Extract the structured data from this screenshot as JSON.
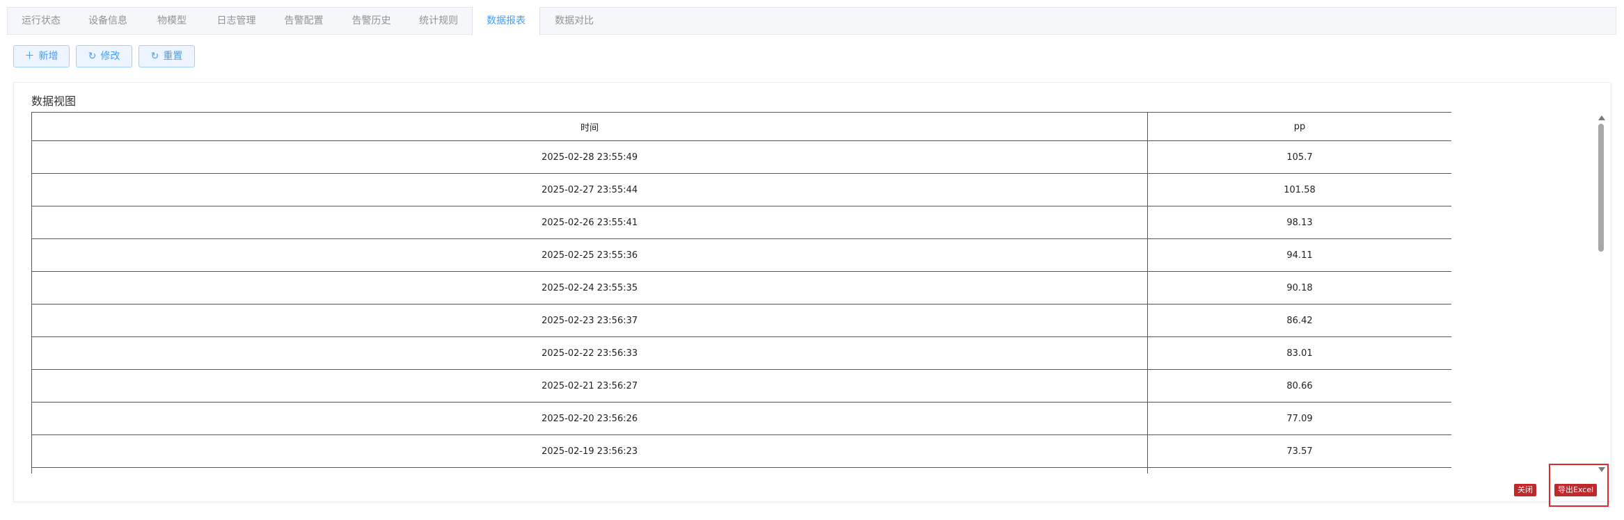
{
  "tabs": [
    {
      "label": "运行状态"
    },
    {
      "label": "设备信息"
    },
    {
      "label": "物模型"
    },
    {
      "label": "日志管理"
    },
    {
      "label": "告警配置"
    },
    {
      "label": "告警历史"
    },
    {
      "label": "统计规则"
    },
    {
      "label": "数据报表",
      "active": true
    },
    {
      "label": "数据对比"
    }
  ],
  "toolbar": {
    "add": {
      "icon": "plus-icon",
      "label": "新增"
    },
    "edit": {
      "icon": "refresh-icon",
      "label": "修改"
    },
    "reset": {
      "icon": "refresh-icon",
      "label": "重置"
    }
  },
  "card": {
    "title": "数据视图"
  },
  "table": {
    "columns": [
      "时间",
      "pp"
    ],
    "rows": [
      [
        "2025-02-28 23:55:49",
        "105.7"
      ],
      [
        "2025-02-27 23:55:44",
        "101.58"
      ],
      [
        "2025-02-26 23:55:41",
        "98.13"
      ],
      [
        "2025-02-25 23:55:36",
        "94.11"
      ],
      [
        "2025-02-24 23:55:35",
        "90.18"
      ],
      [
        "2025-02-23 23:56:37",
        "86.42"
      ],
      [
        "2025-02-22 23:56:33",
        "83.01"
      ],
      [
        "2025-02-21 23:56:27",
        "80.66"
      ],
      [
        "2025-02-20 23:56:26",
        "77.09"
      ],
      [
        "2025-02-19 23:56:23",
        "73.57"
      ],
      [
        "",
        ""
      ]
    ]
  },
  "actions": {
    "close": "关闭",
    "export": "导出Excel"
  },
  "colors": {
    "accent": "#409eff",
    "danger": "#c0292b",
    "highlight": "#e6262a"
  }
}
